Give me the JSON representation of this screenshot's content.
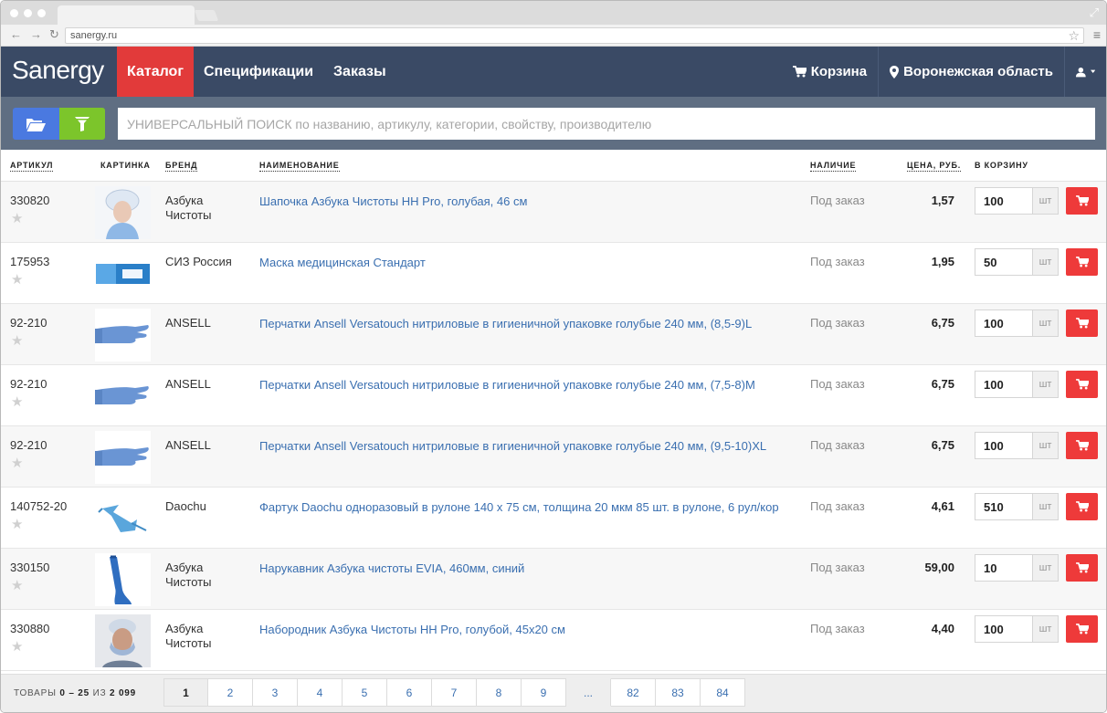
{
  "browser": {
    "url": "sanergy.ru"
  },
  "header": {
    "logo": "Sanergy",
    "nav": [
      {
        "label": "Каталог",
        "active": true
      },
      {
        "label": "Спецификации",
        "active": false
      },
      {
        "label": "Заказы",
        "active": false
      }
    ],
    "cart_label": "Корзина",
    "region_label": "Воронежская область"
  },
  "search": {
    "placeholder": "УНИВЕРСАЛЬНЫЙ ПОИСК по названию, артикулу, категории, свойству, производителю"
  },
  "table": {
    "columns": {
      "sku": "АРТИКУЛ",
      "image": "КАРТИНКА",
      "brand": "БРЕНД",
      "name": "НАИМЕНОВАНИЕ",
      "availability": "НАЛИЧИЕ",
      "price": "ЦЕНА, РУБ.",
      "to_cart": "В КОРЗИНУ"
    },
    "unit": "шт",
    "rows": [
      {
        "sku": "330820",
        "brand": "Азбука Чистоты",
        "name": "Шапочка Азбука Чистоты HH Pro, голубая, 46 см",
        "availability": "Под заказ",
        "price": "1,57",
        "qty": "100",
        "image": "cap-photo"
      },
      {
        "sku": "175953",
        "brand": "СИЗ Россия",
        "name": "Маска медицинская Стандарт",
        "availability": "Под заказ",
        "price": "1,95",
        "qty": "50",
        "image": "mask-box-photo"
      },
      {
        "sku": "92-210",
        "brand": "ANSELL",
        "name": "Перчатки Ansell Versatouch нитриловые в гигиеничной упаковке голубые 240 мм, (8,5-9)L",
        "availability": "Под заказ",
        "price": "6,75",
        "qty": "100",
        "image": "glove-photo"
      },
      {
        "sku": "92-210",
        "brand": "ANSELL",
        "name": "Перчатки Ansell Versatouch нитриловые в гигиеничной упаковке голубые 240 мм, (7,5-8)M",
        "availability": "Под заказ",
        "price": "6,75",
        "qty": "100",
        "image": "glove-photo"
      },
      {
        "sku": "92-210",
        "brand": "ANSELL",
        "name": "Перчатки Ansell Versatouch нитриловые в гигиеничной упаковке голубые 240 мм, (9,5-10)XL",
        "availability": "Под заказ",
        "price": "6,75",
        "qty": "100",
        "image": "glove-photo"
      },
      {
        "sku": "140752-20",
        "brand": "Daochu",
        "name": "Фартук Daochu одноразовый в рулоне 140 х 75 см, толщина 20 мкм 85 шт. в рулоне, 6 рул/кор",
        "availability": "Под заказ",
        "price": "4,61",
        "qty": "510",
        "image": "apron-photo"
      },
      {
        "sku": "330150",
        "brand": "Азбука Чистоты",
        "name": "Нарукавник Азбука чистоты EVIA, 460мм, синий",
        "availability": "Под заказ",
        "price": "59,00",
        "qty": "10",
        "image": "sleeve-photo"
      },
      {
        "sku": "330880",
        "brand": "Азбука Чистоты",
        "name": "Набородник Азбука Чистоты HH Pro, голубой, 45х20 см",
        "availability": "Под заказ",
        "price": "4,40",
        "qty": "100",
        "image": "hood-photo"
      }
    ]
  },
  "footer": {
    "total_prefix": "ТОВАРЫ",
    "total_range": "0 – 25",
    "total_of": "ИЗ",
    "total_count": "2 099",
    "pages": [
      "1",
      "2",
      "3",
      "4",
      "5",
      "6",
      "7",
      "8",
      "9",
      "...",
      "82",
      "83",
      "84"
    ],
    "current_page": "1"
  },
  "colors": {
    "header_bg": "#3a4a65",
    "active_nav": "#e23a3a",
    "search_band": "#5f6e82",
    "folder_button": "#4a79e0",
    "filter_button": "#7cc52b",
    "cart_button": "#ee3a3a",
    "link": "#3a6fb0"
  }
}
